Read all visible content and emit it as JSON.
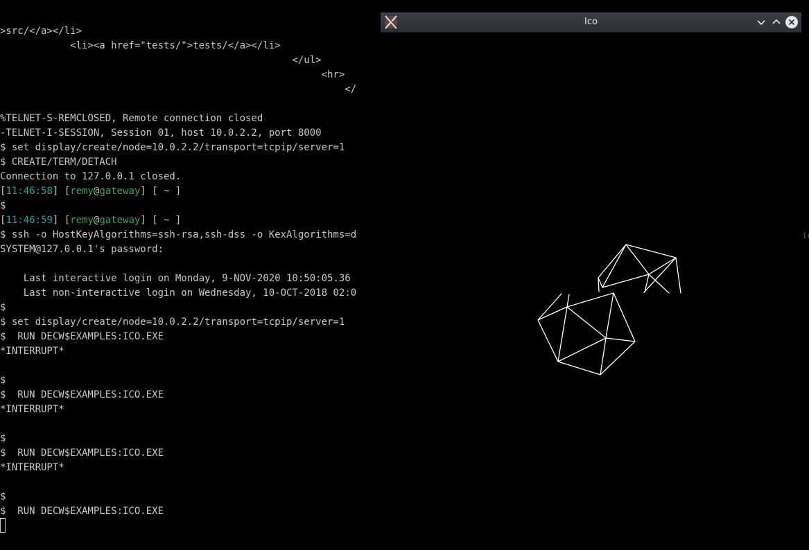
{
  "terminal": {
    "lines": [
      ">src/</a></li>",
      "            <li><a href=\"tests/\">tests/</a></li>",
      "                                                  </ul>",
      "                                                       <hr>",
      "                                                           </",
      "",
      "%TELNET-S-REMCLOSED, Remote connection closed",
      "-TELNET-I-SESSION, Session 01, host 10.0.2.2, port 8000",
      "$ set display/create/node=10.0.2.2/transport=tcpip/server=1",
      "$ CREATE/TERM/DETACH",
      "Connection to 127.0.0.1 closed.",
      "",
      "$",
      "",
      "$ ssh -o HostKeyAlgorithms=ssh-rsa,ssh-dss -o KexAlgorithms=d",
      "SYSTEM@127.0.0.1's password:",
      "",
      "    Last interactive login on Monday, 9-NOV-2020 10:50:05.36",
      "    Last non-interactive login on Wednesday, 10-OCT-2018 02:0",
      "$",
      "$ set display/create/node=10.0.2.2/transport=tcpip/server=1",
      "$  RUN DECW$EXAMPLES:ICO.EXE",
      "*INTERRUPT*",
      "",
      "$",
      "$  RUN DECW$EXAMPLES:ICO.EXE",
      "*INTERRUPT*",
      "",
      "$",
      "$  RUN DECW$EXAMPLES:ICO.EXE",
      "*INTERRUPT*",
      "",
      "$",
      "$  RUN DECW$EXAMPLES:ICO.EXE"
    ],
    "prompt1": {
      "open": "[",
      "time": "11:46:58",
      "mid": "] [",
      "user": "remy",
      "at": "@",
      "host": "gateway",
      "rest": "] [ ~ ]"
    },
    "prompt2": {
      "open": "[",
      "time": "11:46:59",
      "mid": "] [",
      "user": "remy",
      "at": "@",
      "host": "gateway",
      "rest": "] [ ~ ]"
    },
    "edge_glyph": "ic"
  },
  "window": {
    "title": "Ico",
    "app_icon": "x11-icon",
    "buttons": [
      "minimize-chevron-down-icon",
      "maximize-chevron-up-icon",
      "close-icon"
    ],
    "colors": {
      "titlebar": "#2c3036",
      "close_bg": "#e6e6e6",
      "wireframe": "#ffffff"
    }
  },
  "colors": {
    "text": "#c8c8c8",
    "time": "#1aa3a3",
    "user_host": "#3fa34a",
    "background": "#000000"
  }
}
